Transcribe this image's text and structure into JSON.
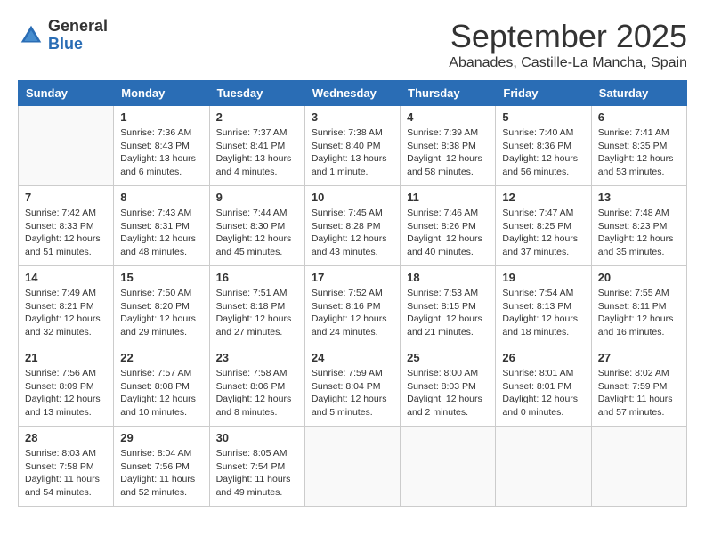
{
  "header": {
    "logo_general": "General",
    "logo_blue": "Blue",
    "month_title": "September 2025",
    "location": "Abanades, Castille-La Mancha, Spain"
  },
  "days_of_week": [
    "Sunday",
    "Monday",
    "Tuesday",
    "Wednesday",
    "Thursday",
    "Friday",
    "Saturday"
  ],
  "weeks": [
    [
      {
        "day": "",
        "info": ""
      },
      {
        "day": "1",
        "info": "Sunrise: 7:36 AM\nSunset: 8:43 PM\nDaylight: 13 hours\nand 6 minutes."
      },
      {
        "day": "2",
        "info": "Sunrise: 7:37 AM\nSunset: 8:41 PM\nDaylight: 13 hours\nand 4 minutes."
      },
      {
        "day": "3",
        "info": "Sunrise: 7:38 AM\nSunset: 8:40 PM\nDaylight: 13 hours\nand 1 minute."
      },
      {
        "day": "4",
        "info": "Sunrise: 7:39 AM\nSunset: 8:38 PM\nDaylight: 12 hours\nand 58 minutes."
      },
      {
        "day": "5",
        "info": "Sunrise: 7:40 AM\nSunset: 8:36 PM\nDaylight: 12 hours\nand 56 minutes."
      },
      {
        "day": "6",
        "info": "Sunrise: 7:41 AM\nSunset: 8:35 PM\nDaylight: 12 hours\nand 53 minutes."
      }
    ],
    [
      {
        "day": "7",
        "info": "Sunrise: 7:42 AM\nSunset: 8:33 PM\nDaylight: 12 hours\nand 51 minutes."
      },
      {
        "day": "8",
        "info": "Sunrise: 7:43 AM\nSunset: 8:31 PM\nDaylight: 12 hours\nand 48 minutes."
      },
      {
        "day": "9",
        "info": "Sunrise: 7:44 AM\nSunset: 8:30 PM\nDaylight: 12 hours\nand 45 minutes."
      },
      {
        "day": "10",
        "info": "Sunrise: 7:45 AM\nSunset: 8:28 PM\nDaylight: 12 hours\nand 43 minutes."
      },
      {
        "day": "11",
        "info": "Sunrise: 7:46 AM\nSunset: 8:26 PM\nDaylight: 12 hours\nand 40 minutes."
      },
      {
        "day": "12",
        "info": "Sunrise: 7:47 AM\nSunset: 8:25 PM\nDaylight: 12 hours\nand 37 minutes."
      },
      {
        "day": "13",
        "info": "Sunrise: 7:48 AM\nSunset: 8:23 PM\nDaylight: 12 hours\nand 35 minutes."
      }
    ],
    [
      {
        "day": "14",
        "info": "Sunrise: 7:49 AM\nSunset: 8:21 PM\nDaylight: 12 hours\nand 32 minutes."
      },
      {
        "day": "15",
        "info": "Sunrise: 7:50 AM\nSunset: 8:20 PM\nDaylight: 12 hours\nand 29 minutes."
      },
      {
        "day": "16",
        "info": "Sunrise: 7:51 AM\nSunset: 8:18 PM\nDaylight: 12 hours\nand 27 minutes."
      },
      {
        "day": "17",
        "info": "Sunrise: 7:52 AM\nSunset: 8:16 PM\nDaylight: 12 hours\nand 24 minutes."
      },
      {
        "day": "18",
        "info": "Sunrise: 7:53 AM\nSunset: 8:15 PM\nDaylight: 12 hours\nand 21 minutes."
      },
      {
        "day": "19",
        "info": "Sunrise: 7:54 AM\nSunset: 8:13 PM\nDaylight: 12 hours\nand 18 minutes."
      },
      {
        "day": "20",
        "info": "Sunrise: 7:55 AM\nSunset: 8:11 PM\nDaylight: 12 hours\nand 16 minutes."
      }
    ],
    [
      {
        "day": "21",
        "info": "Sunrise: 7:56 AM\nSunset: 8:09 PM\nDaylight: 12 hours\nand 13 minutes."
      },
      {
        "day": "22",
        "info": "Sunrise: 7:57 AM\nSunset: 8:08 PM\nDaylight: 12 hours\nand 10 minutes."
      },
      {
        "day": "23",
        "info": "Sunrise: 7:58 AM\nSunset: 8:06 PM\nDaylight: 12 hours\nand 8 minutes."
      },
      {
        "day": "24",
        "info": "Sunrise: 7:59 AM\nSunset: 8:04 PM\nDaylight: 12 hours\nand 5 minutes."
      },
      {
        "day": "25",
        "info": "Sunrise: 8:00 AM\nSunset: 8:03 PM\nDaylight: 12 hours\nand 2 minutes."
      },
      {
        "day": "26",
        "info": "Sunrise: 8:01 AM\nSunset: 8:01 PM\nDaylight: 12 hours\nand 0 minutes."
      },
      {
        "day": "27",
        "info": "Sunrise: 8:02 AM\nSunset: 7:59 PM\nDaylight: 11 hours\nand 57 minutes."
      }
    ],
    [
      {
        "day": "28",
        "info": "Sunrise: 8:03 AM\nSunset: 7:58 PM\nDaylight: 11 hours\nand 54 minutes."
      },
      {
        "day": "29",
        "info": "Sunrise: 8:04 AM\nSunset: 7:56 PM\nDaylight: 11 hours\nand 52 minutes."
      },
      {
        "day": "30",
        "info": "Sunrise: 8:05 AM\nSunset: 7:54 PM\nDaylight: 11 hours\nand 49 minutes."
      },
      {
        "day": "",
        "info": ""
      },
      {
        "day": "",
        "info": ""
      },
      {
        "day": "",
        "info": ""
      },
      {
        "day": "",
        "info": ""
      }
    ]
  ]
}
